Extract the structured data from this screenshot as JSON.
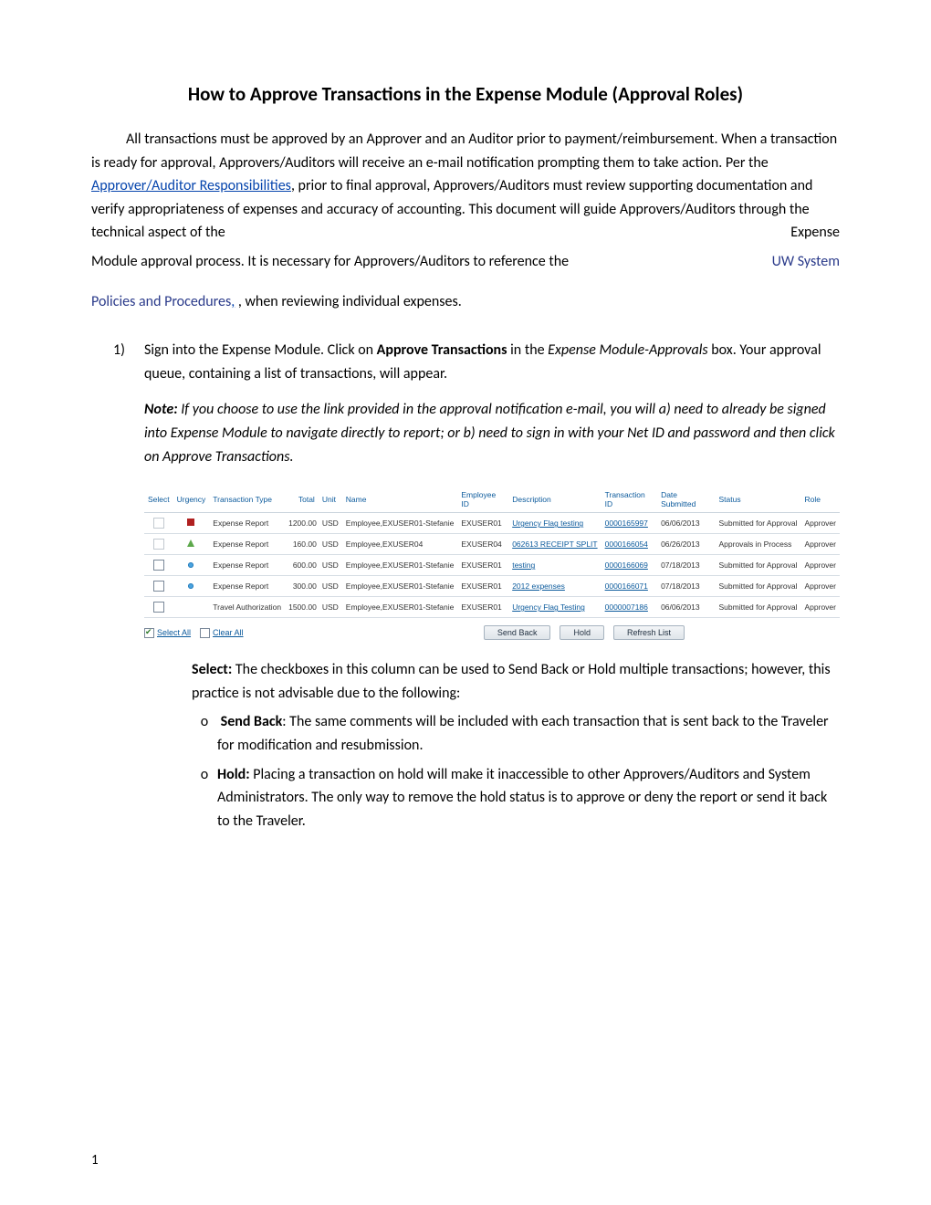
{
  "title": "How to Approve Transactions in the Expense Module (Approval Roles)",
  "para1_a": "All transactions must be approved by an Approver and an Auditor prior to payment/reimbursement.  When a transaction is ready for approval, Approvers/Auditors will receive an e-mail notification prompting them to take action.  Per the ",
  "para1_link1": "Approver/Auditor Responsibilities",
  "para1_b": ", prior to final approval, Approvers/Auditors must review supporting documentation and verify appropriateness of expenses and accuracy of accounting.  This document will guide Approvers/Auditors through the technical aspect of the ",
  "para1_float1": "Expense",
  "para1_c": "Module approval process.  It is necessary for Approvers/Auditors to reference the ",
  "para1_float2": "UW System",
  "policies_link": "Policies and Procedures",
  "policies_tail": ", when reviewing individual expenses.",
  "step1_num": "1)",
  "step1_a": "Sign into the Expense Module.  Click on ",
  "step1_b": "Approve Transactions",
  "step1_c": " in the ",
  "step1_d": "Expense Module-Approvals",
  "step1_e": " box.  Your approval queue, containing a list of transactions, will appear.",
  "note_label": "Note:",
  "note_body": " If you choose to use the link provided in the approval notification e-mail, you will a) need to already be signed into Expense Module to navigate directly to report; or b) need to sign in with your Net ID and password and then click on Approve Transactions.",
  "headers": {
    "select": "Select",
    "urgency": "Urgency",
    "ttype": "Transaction Type",
    "total": "Total",
    "unit": "Unit",
    "name": "Name",
    "empid": "Employee ID",
    "desc": "Description",
    "tid": "Transaction ID",
    "date": "Date Submitted",
    "status": "Status",
    "role": "Role"
  },
  "rows": [
    {
      "sel": "dim",
      "urg": "red",
      "ttype": "Expense Report",
      "total": "1200.00",
      "unit": "USD",
      "name": "Employee,EXUSER01-Stefanie",
      "empid": "EXUSER01",
      "desc": "Urgency Flag testing",
      "tid": "0000165997",
      "date": "06/06/2013",
      "status": "Submitted for Approval",
      "role": "Approver"
    },
    {
      "sel": "dim",
      "urg": "green",
      "ttype": "Expense Report",
      "total": "160.00",
      "unit": "USD",
      "name": "Employee,EXUSER04",
      "empid": "EXUSER04",
      "desc": "062613 RECEIPT SPLIT",
      "tid": "0000166054",
      "date": "06/26/2013",
      "status": "Approvals in Process",
      "role": "Approver"
    },
    {
      "sel": "on",
      "urg": "blue",
      "ttype": "Expense Report",
      "total": "600.00",
      "unit": "USD",
      "name": "Employee,EXUSER01-Stefanie",
      "empid": "EXUSER01",
      "desc": "testing",
      "tid": "0000166069",
      "date": "07/18/2013",
      "status": "Submitted for Approval",
      "role": "Approver"
    },
    {
      "sel": "on",
      "urg": "blue",
      "ttype": "Expense Report",
      "total": "300.00",
      "unit": "USD",
      "name": "Employee,EXUSER01-Stefanie",
      "empid": "EXUSER01",
      "desc": "2012 expenses",
      "tid": "0000166071",
      "date": "07/18/2013",
      "status": "Submitted for Approval",
      "role": "Approver"
    },
    {
      "sel": "on",
      "urg": "",
      "ttype": "Travel Authorization",
      "total": "1500.00",
      "unit": "USD",
      "name": "Employee,EXUSER01-Stefanie",
      "empid": "EXUSER01",
      "desc": "Urgency Flag Testing",
      "tid": "0000007186",
      "date": "06/06/2013",
      "status": "Submitted for Approval",
      "role": "Approver"
    }
  ],
  "actions": {
    "select_all": "Select All",
    "clear_all": "Clear All",
    "send_back": "Send Back",
    "hold": "Hold",
    "refresh": "Refresh List"
  },
  "select_label": "Select:",
  "select_text": "  The checkboxes in this column can be used to Send Back or Hold multiple transactions; however, this practice is not advisable due to the following:",
  "sb_label": "Send Back",
  "sb_text": ":  The same comments will be included with each transaction that is sent back to the Traveler for modification and resubmission.",
  "hold_label": "Hold:",
  "hold_text": " Placing a transaction on hold will make it inaccessible to other Approvers/Auditors and System Administrators.  The only way to remove the hold status is to approve or deny the report or send it back to the Traveler.",
  "circle": "o",
  "pageno": "1"
}
